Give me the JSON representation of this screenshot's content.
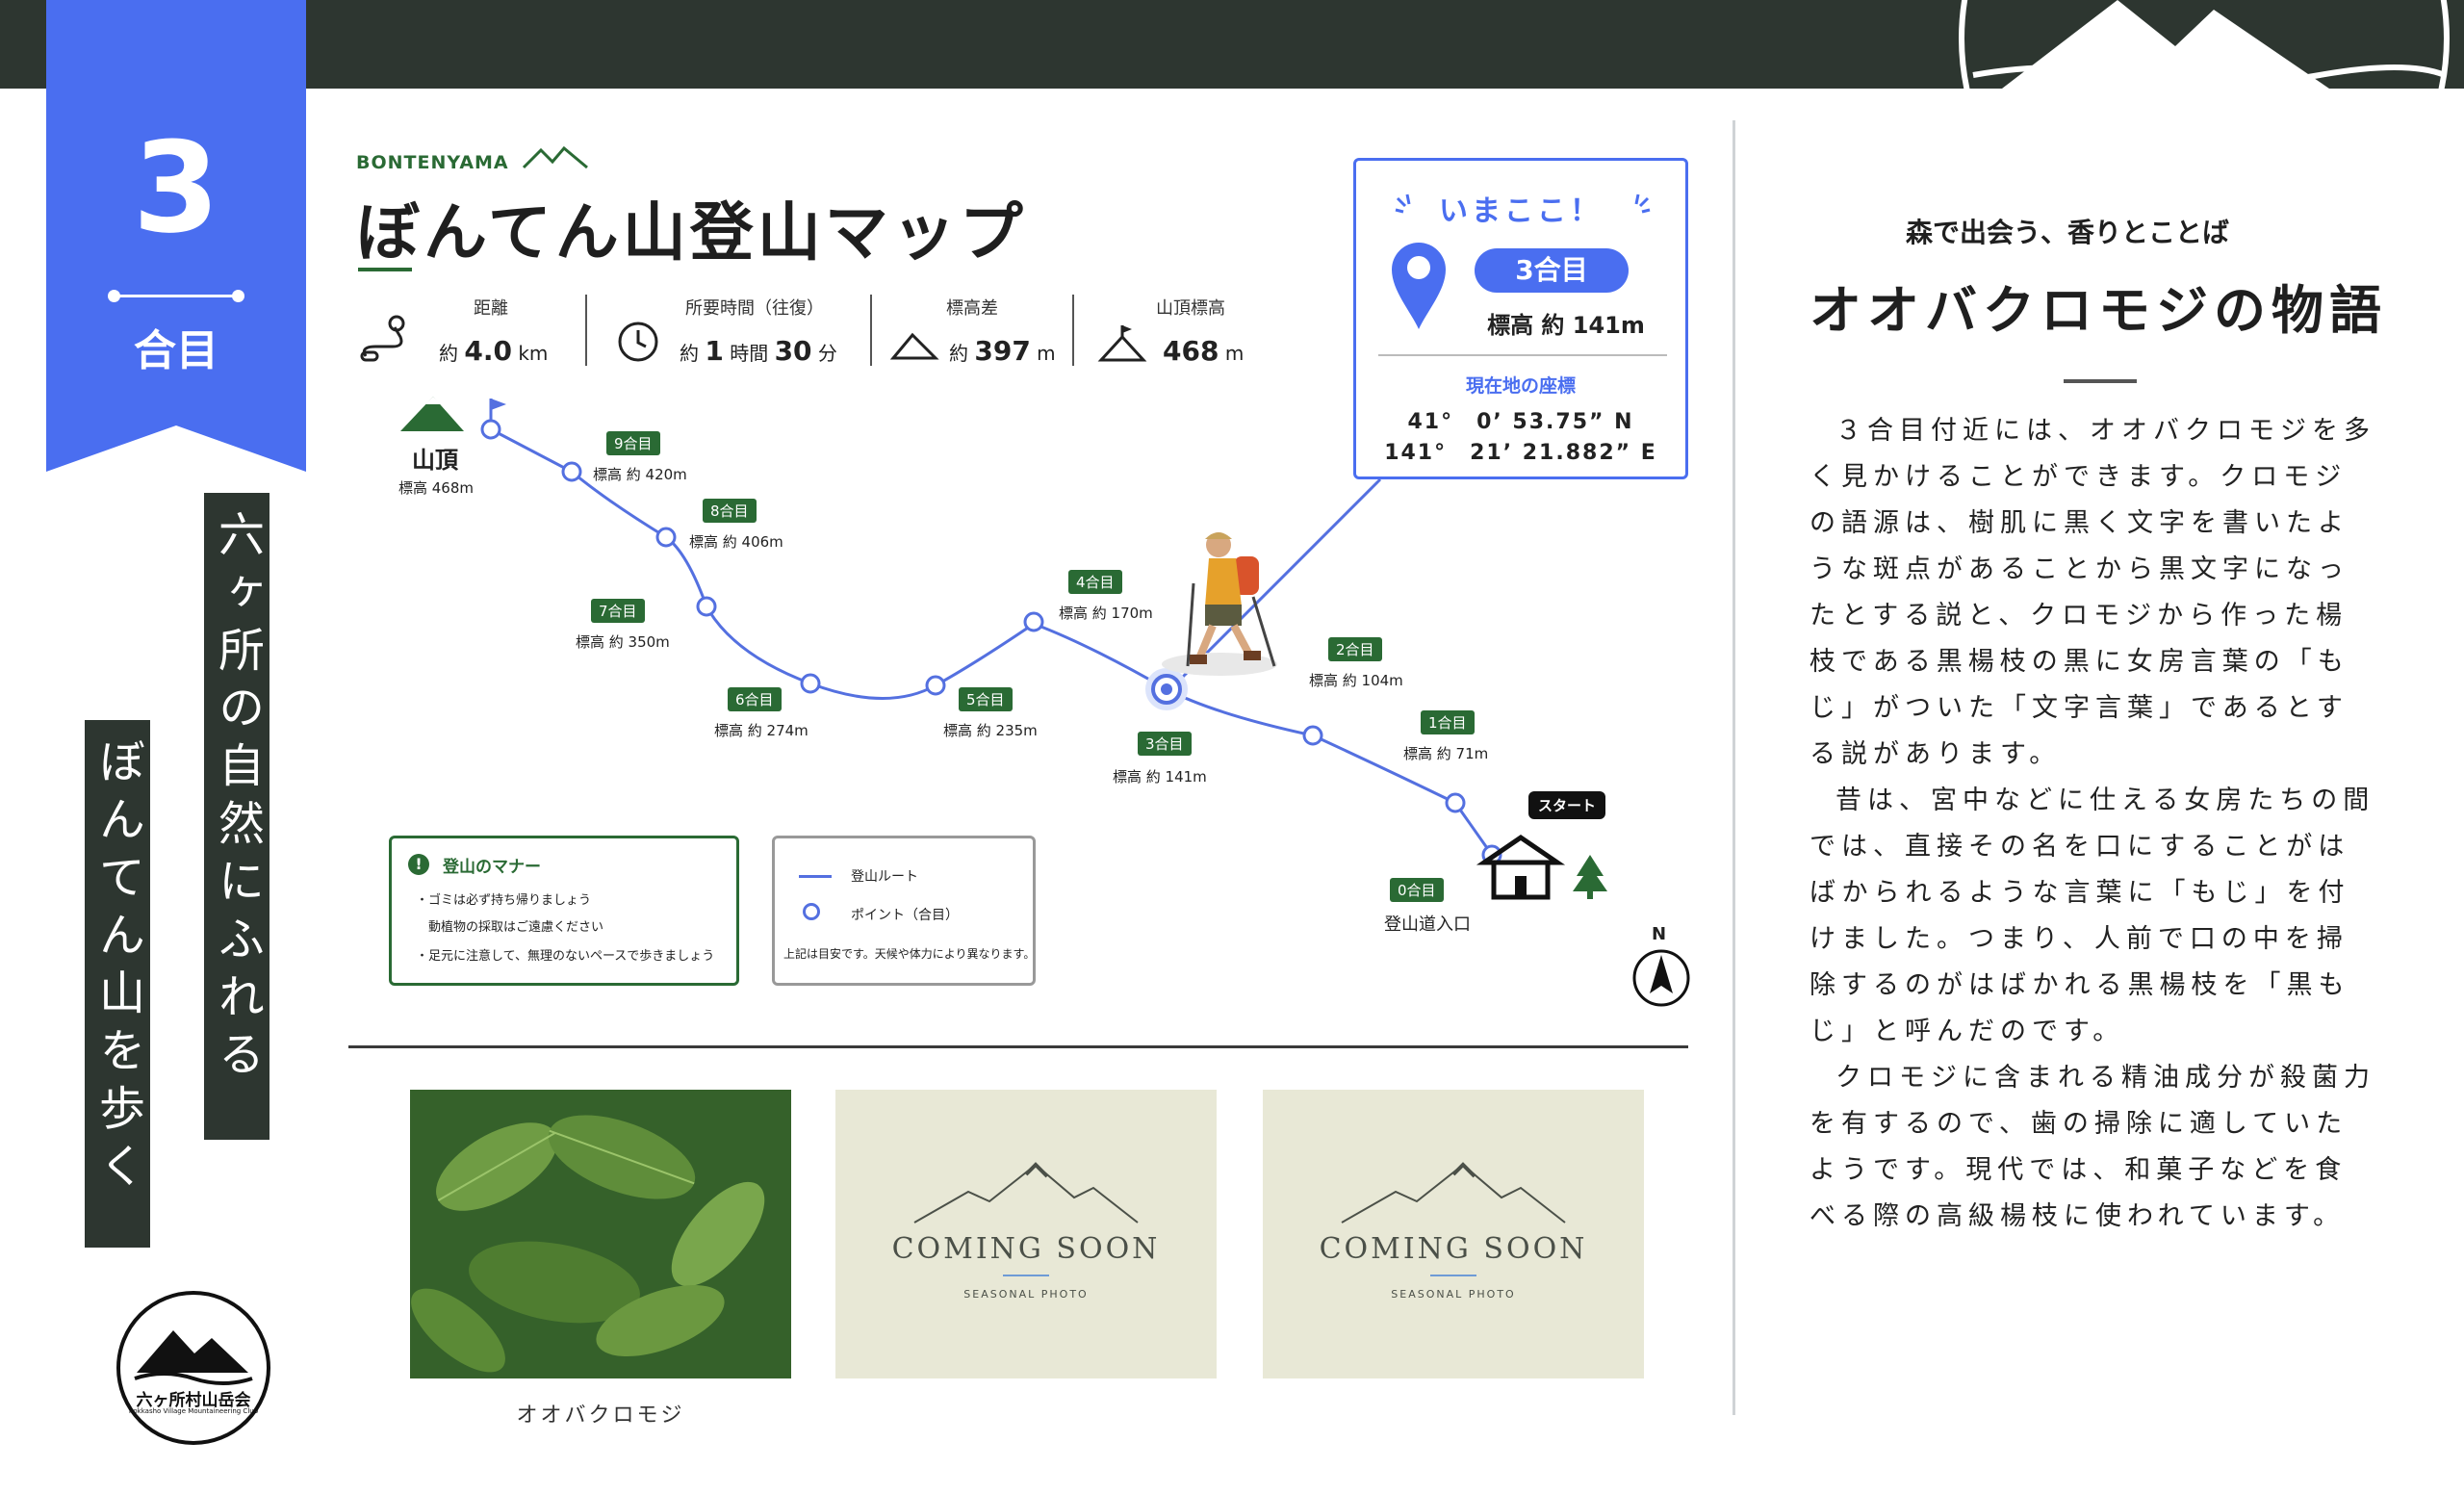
{
  "badge": {
    "number": "3",
    "label": "合目",
    "color": "#4a6ef0"
  },
  "vertical": {
    "line1": "六ヶ所の自然にふれる",
    "line2": "ぼんてん山を歩く"
  },
  "club": {
    "name": "六ヶ所村山岳会",
    "name_en": "Rokkasho Village Mountaineering Club"
  },
  "map": {
    "brand": "BONTENYAMA",
    "title": "ぼんてん山登山マップ",
    "stats": [
      {
        "label": "距離",
        "prefix": "約",
        "value": "4.0",
        "unit": "km"
      },
      {
        "label": "所要時間（往復）",
        "prefix": "約",
        "value": "1",
        "unit": "時間",
        "value2": "30",
        "unit2": "分"
      },
      {
        "label": "標高差",
        "prefix": "約",
        "value": "397",
        "unit": "m"
      },
      {
        "label": "山頂標高",
        "prefix": "",
        "value": "468",
        "unit": "m"
      }
    ],
    "summit": {
      "name": "山頂",
      "elev": "標高 468m"
    },
    "stations": [
      {
        "tag": "9合目",
        "elev": "標高 約 420m"
      },
      {
        "tag": "8合目",
        "elev": "標高 約 406m"
      },
      {
        "tag": "7合目",
        "elev": "標高 約 350m"
      },
      {
        "tag": "6合目",
        "elev": "標高 約 274m"
      },
      {
        "tag": "5合目",
        "elev": "標高 約 235m"
      },
      {
        "tag": "4合目",
        "elev": "標高 約 170m"
      },
      {
        "tag": "3合目",
        "elev": "標高 約 141m"
      },
      {
        "tag": "2合目",
        "elev": "標高 約 104m"
      },
      {
        "tag": "1合目",
        "elev": "標高 約 71m"
      },
      {
        "tag": "0合目",
        "elev": "登山道入口"
      }
    ],
    "start_label": "スタート",
    "north": "N",
    "here": {
      "title": "いまここ！",
      "station": "3合目",
      "elev": "標高 約 141m",
      "coord_label": "現在地の座標",
      "lat": "41°　0’ 53.75” N",
      "lon": "141°　21’ 21.882” E"
    },
    "manners": {
      "title": "登山のマナー",
      "items": [
        "・ゴミは必ず持ち帰りましょう",
        "　動植物の採取はご遠慮ください",
        "・足元に注意して、無理のないペースで歩きましょう"
      ]
    },
    "legend": {
      "route": "登山ルート",
      "point": "ポイント（合目）",
      "note": "上記は目安です。天候や体力により異なります。"
    },
    "colors": {
      "route": "#5470e0",
      "accent": "#4a6ef0",
      "green": "#2a6a34",
      "dark": "#2d3630"
    }
  },
  "photos": {
    "caption1": "オオバクロモジ",
    "soon_title": "COMING SOON",
    "soon_sub": "SEASONAL PHOTO"
  },
  "story": {
    "subtitle": "森で出会う、香りとことば",
    "title": "オオバクロモジの物語",
    "paragraphs": [
      "３合目付近には、オオバクロモジを多く見かけることができます。クロモジの語源は、樹肌に黒く文字を書いたような斑点があることから黒文字になったとする説と、クロモジから作った楊枝である黒楊枝の黒に女房言葉の「もじ」がついた「文字言葉」であるとする説があります。",
      "昔は、宮中などに仕える女房たちの間では、直接その名を口にすることがはばかられるような言葉に「もじ」を付けました。つまり、人前で口の中を掃除するのがはばかれる黒楊枝を「黒もじ」と呼んだのです。",
      "クロモジに含まれる精油成分が殺菌力を有するので、歯の掃除に適していたようです。現代では、和菓子などを食べる際の高級楊枝に使われています。"
    ]
  }
}
